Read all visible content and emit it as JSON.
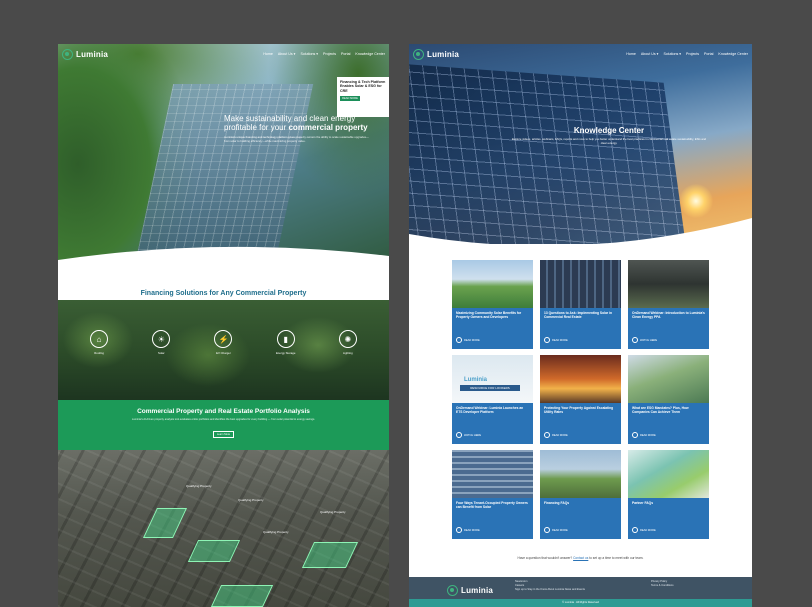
{
  "left_page": {
    "brand": "Luminia",
    "nav": [
      "Home",
      "About Us ▾",
      "Solutions ▾",
      "Projects",
      "Portal",
      "Knowledge Center"
    ],
    "promo": {
      "title": "Financing & Tech Platform Enables Solar & ESG for CRE",
      "button": "READ MORE"
    },
    "hero": {
      "headline_pre": "Make sustainability and clean energy profitable for your ",
      "headline_bold": "commercial property",
      "body": "Luminia's unique financing and technology platform gives property owners the ability to scale sustainable upgrades—from solar to building efficiency—while maximizing property value."
    },
    "financing": {
      "title": "Financing Solutions for Any Commercial Property",
      "body": "With multiple financing options for energy and sustainability upgrades that leverage the benefits of the full spectrum of commercial property (C-PACE) programs, Luminia helps property owners and investors fund projects with no upfront capital while reducing operating expenses.",
      "button": "Learn More"
    },
    "icons": [
      {
        "icon": "roofing-icon",
        "glyph": "⌂",
        "label": "Roofing"
      },
      {
        "icon": "solar-icon",
        "glyph": "☀",
        "label": "Solar"
      },
      {
        "icon": "ev-charger-icon",
        "glyph": "⚡",
        "label": "EV Charger"
      },
      {
        "icon": "energy-storage-icon",
        "glyph": "▮",
        "label": "Energy Storage"
      },
      {
        "icon": "lighting-icon",
        "glyph": "✺",
        "label": "Lighting"
      }
    ],
    "portfolio": {
      "title": "Commercial Property and Real Estate Portfolio Analysis",
      "body": "Luminia's AI-driven property analysis tool evaluates entire portfolios and identifies the best upgrades for every building — from solar potential to energy savings.",
      "button": "Learn More"
    },
    "aerial_labels": [
      "Qualifying Property",
      "Qualifying Property",
      "Qualifying Property",
      "Qualifying Property"
    ]
  },
  "right_page": {
    "brand": "Luminia",
    "nav": [
      "Home",
      "About Us ▾",
      "Solutions ▾",
      "Projects",
      "Portal",
      "Knowledge Center"
    ],
    "hero": {
      "title": "Knowledge Center",
      "body": "Explore videos, articles, webinars, FAQs, reports and more to help you better understand the best practices in commercial real estate sustainability, ESG and clean energy."
    },
    "cards": [
      {
        "title": "Maximizing Community Solar Benefits for Property Owners and Developers",
        "more": "READ MORE",
        "img": "im1"
      },
      {
        "title": "13 Questions to Ask: Implementing Solar in Commercial Real Estate",
        "more": "READ MORE",
        "img": "im2"
      },
      {
        "title": "OnDemand Webinar: Introduction to Luminia's Clean Energy PPA",
        "more": "WATCH HERE",
        "img": "im3"
      },
      {
        "title": "OnDemand Webinar: Luminia Launches an ETS Developer Platform",
        "more": "WATCH HERE",
        "img": "im4"
      },
      {
        "title": "Protecting Your Property Against Escalating Utility Rates",
        "more": "READ MORE",
        "img": "im5"
      },
      {
        "title": "What are ESG Mandates? Plus, How Companies Can Achieve Them",
        "more": "READ MORE",
        "img": "im6"
      },
      {
        "title": "Four Ways Tenant-Occupied Property Owners can Benefit from Solar",
        "more": "READ MORE",
        "img": "im7"
      },
      {
        "title": "Financing FAQs",
        "more": "READ MORE",
        "img": "im8"
      },
      {
        "title": "Partner FAQs",
        "more": "READ MORE",
        "img": "im9"
      }
    ],
    "card4_logo": "Luminia",
    "card4_bar": "RESOURCE FOR LOOKERS",
    "question_pre": "Have a question that wouldn't answer? ",
    "question_link": "Contact us",
    "question_post": " to set up a time to meet with our team.",
    "footer": {
      "col1": [
        "Newsroom",
        "Careers",
        "Sign up to Stay in the Know About Luminia News and Events"
      ],
      "col2": [
        "Privacy Policy",
        "Terms & Conditions"
      ],
      "copyright": "© Luminia · All Rights Reserved"
    }
  }
}
